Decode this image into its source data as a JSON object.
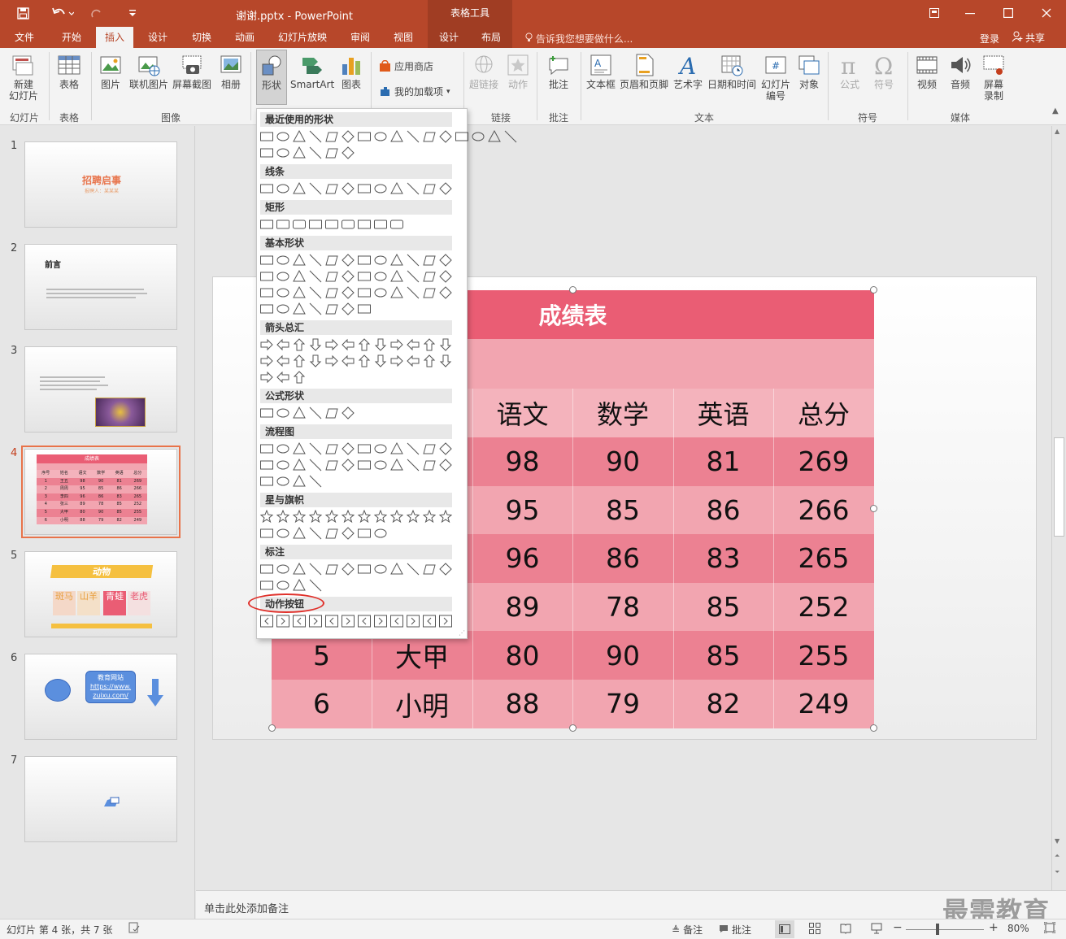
{
  "titlebar": {
    "doc_title": "谢谢.pptx - PowerPoint",
    "context_title": "表格工具",
    "undo_icon": "undo-icon",
    "redo_icon": "redo-icon"
  },
  "tabs": {
    "file": "文件",
    "home": "开始",
    "insert": "插入",
    "design": "设计",
    "transitions": "切换",
    "animations": "动画",
    "slideshow": "幻灯片放映",
    "review": "审阅",
    "view": "视图",
    "table_design": "设计",
    "layout": "布局",
    "tell_me": "告诉我您想要做什么...",
    "login": "登录",
    "share": "共享"
  },
  "ribbon": {
    "new_slide": "新建",
    "new_slide_2": "幻灯片",
    "table": "表格",
    "picture": "图片",
    "online_picture": "联机图片",
    "screenshot": "屏幕截图",
    "album": "相册",
    "shapes": "形状",
    "smartart": "SmartArt",
    "chart": "图表",
    "store": "应用商店",
    "my_addins": "我的加载项",
    "hyperlink": "超链接",
    "action": "动作",
    "comment": "批注",
    "textbox": "文本框",
    "header_footer": "页眉和页脚",
    "wordart": "艺术字",
    "datetime": "日期和时间",
    "slide_number": "幻灯片",
    "slide_number_2": "编号",
    "object": "对象",
    "equation": "公式",
    "symbol": "符号",
    "video": "视频",
    "audio": "音频",
    "screen_record": "屏幕",
    "screen_record_2": "录制",
    "groups": {
      "slides": "幻灯片",
      "tables": "表格",
      "images": "图像",
      "links": "链接",
      "comments": "批注",
      "text": "文本",
      "symbols": "符号",
      "media": "媒体"
    }
  },
  "shapes_menu": {
    "recent": "最近使用的形状",
    "lines": "线条",
    "rectangles": "矩形",
    "basic": "基本形状",
    "arrows": "箭头总汇",
    "equation": "公式形状",
    "flowchart": "流程图",
    "stars": "星与旗帜",
    "callouts": "标注",
    "action_buttons": "动作按钮"
  },
  "thumbnails": [
    {
      "num": "1",
      "title": "招聘启事",
      "sub": "报聘人：某某某"
    },
    {
      "num": "2",
      "title": "前言"
    },
    {
      "num": "3",
      "title": ""
    },
    {
      "num": "4",
      "title": "成绩表"
    },
    {
      "num": "5",
      "title": "动物",
      "chars": [
        "斑马",
        "山羊",
        "青蛙",
        "老虎"
      ]
    },
    {
      "num": "6",
      "title": "",
      "bubble": "教育网站",
      "link": "https://www.zuixu.com/"
    },
    {
      "num": "7",
      "title": ""
    }
  ],
  "thumb4_table": {
    "header": [
      "序号",
      "姓名",
      "语文",
      "数学",
      "英语",
      "总分"
    ],
    "rows": [
      [
        "1",
        "王五",
        "98",
        "90",
        "81",
        "269"
      ],
      [
        "2",
        "周周",
        "95",
        "85",
        "86",
        "266"
      ],
      [
        "3",
        "李四",
        "96",
        "86",
        "83",
        "265"
      ],
      [
        "4",
        "张三",
        "89",
        "78",
        "85",
        "252"
      ],
      [
        "5",
        "大甲",
        "80",
        "90",
        "85",
        "255"
      ],
      [
        "6",
        "小明",
        "88",
        "79",
        "82",
        "249"
      ]
    ]
  },
  "table": {
    "title": "成绩表",
    "headers_visible": [
      "语文",
      "数学",
      "英语",
      "总分"
    ],
    "rows": [
      {
        "cols": [
          "98",
          "90",
          "81",
          "269"
        ]
      },
      {
        "cols": [
          "95",
          "85",
          "86",
          "266"
        ]
      },
      {
        "cols": [
          "96",
          "86",
          "83",
          "265"
        ]
      },
      {
        "cols": [
          "89",
          "78",
          "85",
          "252"
        ]
      },
      {
        "num": "5",
        "name": "大甲",
        "cols": [
          "80",
          "90",
          "85",
          "255"
        ]
      },
      {
        "num": "6",
        "name": "小明",
        "cols": [
          "88",
          "79",
          "82",
          "249"
        ]
      }
    ]
  },
  "notes": {
    "placeholder": "单击此处添加备注"
  },
  "status": {
    "slide_info": "幻灯片 第 4 张，共 7 张",
    "notes": "备注",
    "comments": "批注",
    "zoom": "80%"
  },
  "watermark": "最需教育",
  "colors": {
    "accent": "#b7472a",
    "table_header": "#ea5d74",
    "table_row_a": "#ec8192",
    "table_row_b": "#f2a5b0"
  }
}
